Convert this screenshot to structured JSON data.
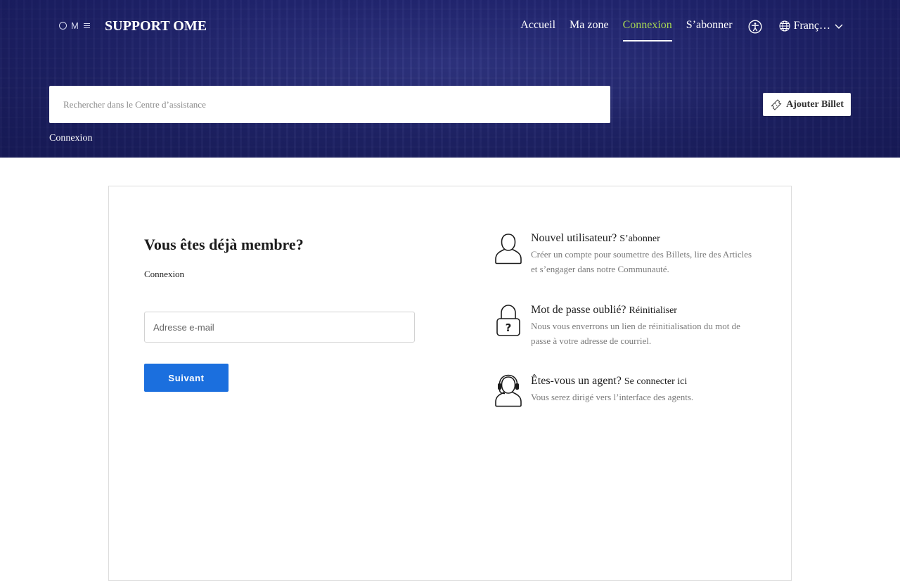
{
  "header": {
    "logo_text": "OME",
    "site_title": "SUPPORT OME",
    "nav": [
      {
        "label": "Accueil",
        "active": false
      },
      {
        "label": "Ma zone",
        "active": false
      },
      {
        "label": "Connexion",
        "active": true
      },
      {
        "label": "S’abonner",
        "active": false
      }
    ],
    "language": "Franç…",
    "active_color": "#a6d653"
  },
  "search": {
    "placeholder": "Rechercher dans le Centre d’assistance"
  },
  "add_ticket": {
    "label": "Ajouter Billet"
  },
  "breadcrumb": {
    "current": "Connexion"
  },
  "login": {
    "title": "Vous êtes déjà membre?",
    "subtitle": "Connexion",
    "email_placeholder": "Adresse e-mail",
    "next_button": "Suivant",
    "button_color": "#1b6fde"
  },
  "info": [
    {
      "icon": "user-icon",
      "heading": "Nouvel utilisateur?",
      "link": "S’abonner",
      "description": "Créer un compte pour soumettre des Billets, lire des Articles et s’engager dans notre Communauté."
    },
    {
      "icon": "lock-question-icon",
      "heading": "Mot de passe oublié?",
      "link": "Réinitialiser",
      "description": "Nous vous enverrons un lien de réinitialisation du mot de passe à votre adresse de courriel."
    },
    {
      "icon": "agent-headset-icon",
      "heading": "Êtes-vous un agent?",
      "link": "Se connecter ici",
      "description": "Vous serez dirigé vers l’interface des agents."
    }
  ]
}
